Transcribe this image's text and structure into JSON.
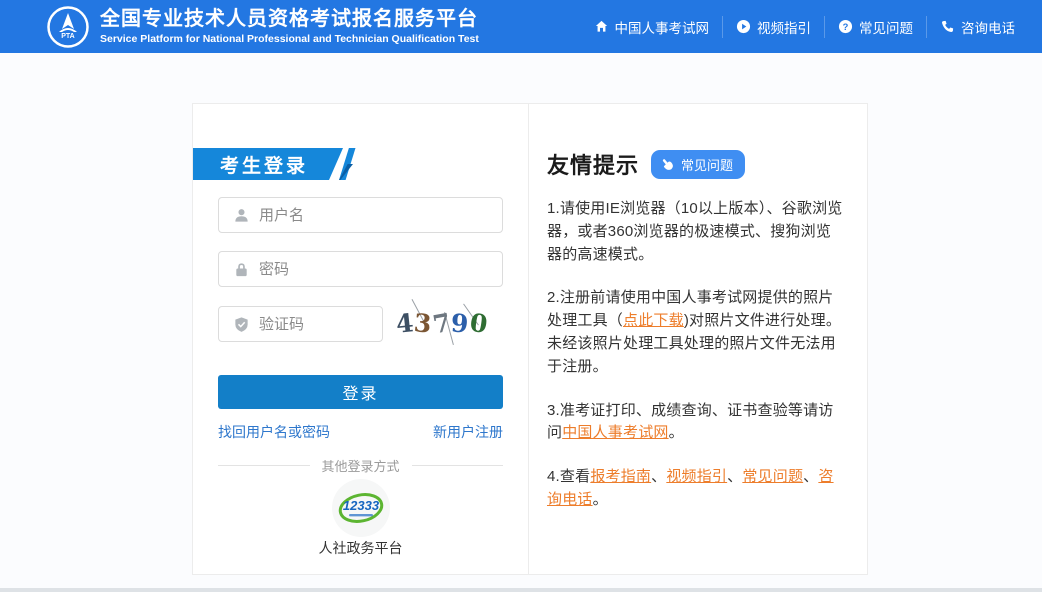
{
  "header": {
    "title": "全国专业技术人员资格考试报名服务平台",
    "subtitle": "Service Platform for National Professional and Technician Qualification Test",
    "nav": [
      {
        "icon": "home-icon",
        "label": "中国人事考试网"
      },
      {
        "icon": "video-play-icon",
        "label": "视频指引"
      },
      {
        "icon": "question-icon",
        "label": "常见问题"
      },
      {
        "icon": "phone-icon",
        "label": "咨询电话"
      }
    ]
  },
  "login": {
    "banner_label": "考生登录",
    "username_placeholder": "用户名",
    "password_placeholder": "密码",
    "captcha_placeholder": "验证码",
    "captcha_code": "43790",
    "captcha_chars": [
      {
        "c": "4",
        "color": "#3d4f63",
        "rot": -6
      },
      {
        "c": "3",
        "color": "#7b5634",
        "rot": 5
      },
      {
        "c": "7",
        "color": "#6e7780",
        "rot": -10
      },
      {
        "c": "9",
        "color": "#2c5faa",
        "rot": 4
      },
      {
        "c": "0",
        "color": "#2f6d33",
        "rot": 8
      }
    ],
    "login_button": "登录",
    "forgot_link": "找回用户名或密码",
    "register_link": "新用户注册",
    "other_login_divider": "其他登录方式",
    "logo_12333_text": "12333",
    "platform_label": "人社政务平台"
  },
  "tips": {
    "title": "友情提示",
    "faq_button": "常见问题",
    "items": [
      {
        "segments": [
          {
            "text": "1.请使用IE浏览器（10以上版本）、谷歌浏览器，或者360浏览器的极速模式、搜狗浏览器的高速模式。"
          }
        ]
      },
      {
        "segments": [
          {
            "text": "2.注册前请使用中国人事考试网提供的照片处理工具（"
          },
          {
            "text": "点此下载",
            "link": true
          },
          {
            "text": ")对照片文件进行处理。未经该照片处理工具处理的照片文件无法用于注册。"
          }
        ]
      },
      {
        "segments": [
          {
            "text": "3.准考证打印、成绩查询、证书查验等请访问"
          },
          {
            "text": "中国人事考试网",
            "link": true
          },
          {
            "text": "。"
          }
        ]
      },
      {
        "segments": [
          {
            "text": "4.查看"
          },
          {
            "text": "报考指南",
            "link": true
          },
          {
            "text": "、"
          },
          {
            "text": "视频指引",
            "link": true
          },
          {
            "text": "、"
          },
          {
            "text": "常见问题",
            "link": true
          },
          {
            "text": "、"
          },
          {
            "text": "咨询电话",
            "link": true
          },
          {
            "text": "。"
          }
        ]
      }
    ]
  },
  "colors": {
    "header_blue": "#2377e2",
    "banner_blue": "#1587da",
    "button_blue": "#137fc8",
    "badge_blue": "#3f8ef2",
    "link_blue": "#2e77cc",
    "link_orange": "#ed7d2b",
    "logo_green": "#5cb531",
    "logo_text_blue": "#1565c0"
  }
}
